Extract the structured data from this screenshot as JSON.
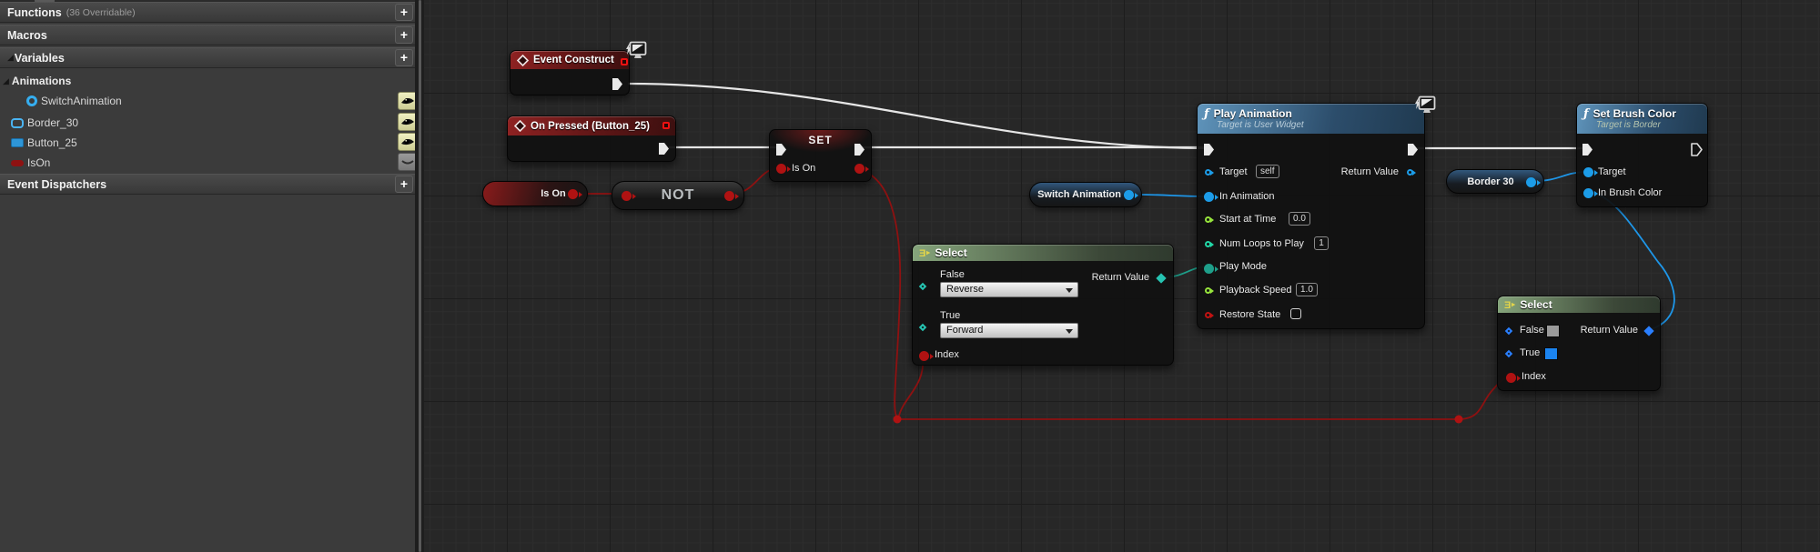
{
  "sidebar": {
    "add_button": "+",
    "sections": {
      "functions": {
        "label": "Functions",
        "note": "(36 Overridable)"
      },
      "macros": {
        "label": "Macros"
      },
      "variables": {
        "label": "Variables"
      },
      "event_dispatchers": {
        "label": "Event Dispatchers"
      }
    },
    "category": {
      "label": "Animations"
    },
    "variables_list": [
      {
        "label": "SwitchAnimation",
        "type": "widget-animation",
        "visible": true
      },
      {
        "label": "Border_30",
        "type": "border",
        "visible": true
      },
      {
        "label": "Button_25",
        "type": "button",
        "visible": true
      },
      {
        "label": "IsOn",
        "type": "boolean",
        "visible": false
      }
    ]
  },
  "graph": {
    "nodes": {
      "event_construct": {
        "title": "Event Construct"
      },
      "on_pressed": {
        "title": "On Pressed (Button_25)"
      },
      "set_is_on": {
        "title": "SET",
        "pin": "Is On"
      },
      "get_is_on": {
        "label": "Is On"
      },
      "not": {
        "label": "NOT"
      },
      "get_switch_animation": {
        "label": "Switch Animation"
      },
      "select_play_mode": {
        "title": "Select",
        "false_label": "False",
        "false_value": "Reverse",
        "true_label": "True",
        "true_value": "Forward",
        "index_label": "Index",
        "return_label": "Return Value"
      },
      "play_animation": {
        "title": "Play Animation",
        "subtitle": "Target is User Widget",
        "target_label": "Target",
        "target_value": "self",
        "in_animation_label": "In Animation",
        "start_label": "Start at Time",
        "start_value": "0.0",
        "loops_label": "Num Loops to Play",
        "loops_value": "1",
        "play_mode_label": "Play Mode",
        "speed_label": "Playback Speed",
        "speed_value": "1.0",
        "restore_label": "Restore State",
        "return_label": "Return Value"
      },
      "get_border_30": {
        "label": "Border 30"
      },
      "set_brush_color": {
        "title": "Set Brush Color",
        "subtitle": "Target is Border",
        "target_label": "Target",
        "brush_label": "In Brush Color"
      },
      "select_color": {
        "title": "Select",
        "false_label": "False",
        "true_label": "True",
        "index_label": "Index",
        "return_label": "Return Value",
        "false_swatch": "#9b9b9b",
        "true_swatch": "#1b84f0",
        "false_swatch_style": "background:#9b9b9b",
        "true_swatch_style": "background:#1b84f0"
      }
    },
    "colors": {
      "exec_wire": "#e6e6e6",
      "bool_pin": "#b01212",
      "bool_wire": "#8e1111",
      "object_pin": "#1c9ce8",
      "float_pin": "#96e33c",
      "int_pin": "#22d6a6",
      "enum_pin": "#1e9f8a",
      "event_header": "#8f2222",
      "function_header": "#5f94bb",
      "select_header": "#85a47b"
    }
  }
}
